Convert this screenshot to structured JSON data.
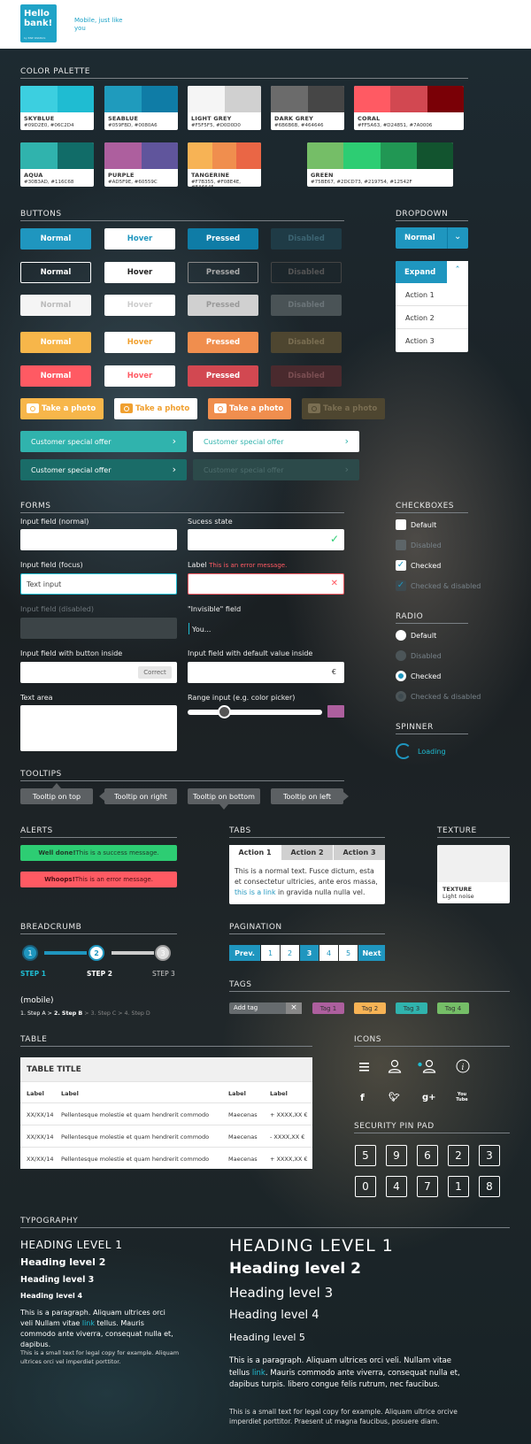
{
  "brand": {
    "logo": "Hello bank!",
    "logo_sub": "by BNP PARIBAS",
    "tagline": "Mobile, just like you"
  },
  "sections": {
    "palette": "COLOR PALETTE",
    "buttons": "BUTTONS",
    "dropdown": "DROPDOWN",
    "forms": "FORMS",
    "checkboxes": "CHECKBOXES",
    "radio": "RADIO",
    "spinner": "SPINNER",
    "tooltips": "TOOLTIPS",
    "alerts": "ALERTS",
    "tabs": "TABS",
    "texture": "TEXTURE",
    "breadcrumb": "BREADCRUMB",
    "pagination": "PAGINATION",
    "tags": "TAGS",
    "table": "TABLE",
    "icons": "ICONS",
    "pinpad": "SECURITY PIN PAD",
    "typography": "TYPOGRAPHY"
  },
  "palette": [
    {
      "name": "SKYBLUE",
      "hex": "#09D2E0, #06C2D4",
      "c": [
        "#3ccfe0",
        "#1fbcd2"
      ]
    },
    {
      "name": "SEABLUE",
      "hex": "#059FBD, #0080A6",
      "c": [
        "#1f9bbd",
        "#0f7ca6"
      ]
    },
    {
      "name": "LIGHT GREY",
      "hex": "#F5F5F5, #D0D0D0",
      "c": [
        "#f5f5f5",
        "#d0d0d0"
      ]
    },
    {
      "name": "DARK GREY",
      "hex": "#6B6B6B, #464646",
      "c": [
        "#6b6b6b",
        "#464646"
      ]
    },
    {
      "name": "CORAL",
      "hex": "#FF5A63, #D24851, #7A0006",
      "c": [
        "#ff5a63",
        "#d24851",
        "#7a0006"
      ]
    },
    {
      "name": "AQUA",
      "hex": "#30B3AD, #116C68",
      "c": [
        "#30b3ad",
        "#116c68"
      ]
    },
    {
      "name": "PURPLE",
      "hex": "#AD5F9E, #60559C",
      "c": [
        "#ad5f9e",
        "#60559c"
      ]
    },
    {
      "name": "TANGERINE",
      "hex": "#F7B355, #F08E4E, #EA6645",
      "c": [
        "#f7b355",
        "#f08e4e",
        "#ea6645"
      ]
    },
    {
      "name": "GREEN",
      "hex": "#75BE67, #2DCD73, #219754, #12542F",
      "c": [
        "#75be67",
        "#2dcd73",
        "#219754",
        "#12542f"
      ]
    }
  ],
  "buttons": {
    "normal": "Normal",
    "hover": "Hover",
    "pressed": "Pressed",
    "disabled": "Disabled",
    "photo": "Take a photo",
    "offer": "Customer special offer"
  },
  "dropdown": {
    "normal": "Normal",
    "expand": "Expand",
    "items": [
      "Action 1",
      "Action 2",
      "Action 3"
    ]
  },
  "forms": {
    "normal_label": "Input field (normal)",
    "success_label": "Sucess state",
    "focus_label": "Input field (focus)",
    "focus_value": "Text input",
    "label": "Label",
    "error_msg": "This is an error message.",
    "disabled_label": "Input field (disabled)",
    "invisible_label": "\"Invisible\" field",
    "invisible_value": "You...",
    "button_inside_label": "Input field with button inside",
    "button_inside_btn": "Correct",
    "default_label": "Input field with default value inside",
    "default_value": "€",
    "textarea_label": "Text area",
    "range_label": "Range input (e.g. color picker)"
  },
  "checkboxes": [
    "Default",
    "Disabled",
    "Checked",
    "Checked & disabled"
  ],
  "radio": [
    "Default",
    "Disabled",
    "Checked",
    "Checked & disabled"
  ],
  "spinner": {
    "label": "Loading"
  },
  "tooltips": [
    "Tooltip on top",
    "Tooltip on right",
    "Tooltip on bottom",
    "Tooltip on left"
  ],
  "alerts": {
    "success_bold": "Well done!",
    "success": " This is a success message.",
    "error_bold": "Whoops!",
    "error": " This is an error message."
  },
  "tabs": {
    "labels": [
      "Action 1",
      "Action 2",
      "Action 3"
    ],
    "text": "This is a normal text. Fusce dictum, esta et consectetur ultricies, ante eros massa,",
    "link": "this is a link",
    "text_end": " in gravida nulla nulla vel."
  },
  "texture": {
    "title": "TEXTURE",
    "sub": "Light noise"
  },
  "breadcrumb": {
    "steps": [
      "1",
      "2",
      "3"
    ],
    "labels": [
      "STEP 1",
      "STEP 2",
      "STEP 3"
    ],
    "mobile_title": "(mobile)",
    "m1": "1. Step A > ",
    "m2": "2. Step B",
    "m3": " > 3. Step C > 4. Step D"
  },
  "pagination": {
    "prev": "Prev.",
    "pages": [
      "1",
      "2",
      "3",
      "4",
      "5"
    ],
    "next": "Next"
  },
  "tags": {
    "input": "Add tag",
    "close": "×",
    "items": [
      "Tag 1",
      "Tag 2",
      "Tag 3",
      "Tag 4"
    ]
  },
  "table": {
    "title": "TABLE TITLE",
    "headers": [
      "Label",
      "Label",
      "Label",
      "Label"
    ],
    "rows": [
      [
        "XX/XX/14",
        "Pellentesque molestie et quam hendrerit commodo",
        "Maecenas",
        "+ XXXX,XX €"
      ],
      [
        "XX/XX/14",
        "Pellentesque molestie et quam hendrerit commodo",
        "Maecenas",
        "- XXXX,XX €"
      ],
      [
        "XX/XX/14",
        "Pellentesque molestie et quam hendrerit commodo",
        "Maecenas",
        "+ XXXX,XX €"
      ]
    ]
  },
  "icons": {
    "row1": [
      "menu-icon",
      "user-icon",
      "user-notify-icon",
      "info-icon"
    ],
    "social": [
      "f",
      "t",
      "g+",
      "You Tube"
    ]
  },
  "pinpad": {
    "keys": [
      "5",
      "9",
      "6",
      "2",
      "3",
      "0",
      "4",
      "7",
      "1",
      "8"
    ]
  },
  "typography": {
    "left": {
      "h1": "HEADING LEVEL 1",
      "h2": "Heading level 2",
      "h3": "Heading level 3",
      "h4": "Heading level 4",
      "p1": "This is a paragraph. Aliquam ultrices orci veli Nullam vitae ",
      "link": "link",
      "p2": " tellus. Mauris commodo ante viverra, consequat nulla et, dapibus.",
      "small": "This is a small text for legal copy for example. Aliquam ultrices orci vel imperdiet porttitor."
    },
    "right": {
      "h1": "HEADING LEVEL 1",
      "h2": "Heading level 2",
      "h3": "Heading level 3",
      "h4": "Heading level 4",
      "h5": "Heading level 5",
      "p1": "This is a paragraph. Aliquam ultrices orci veli. Nullam vitae tellus ",
      "link": "link",
      "p2": ". Mauris commodo ante viverra, consequat nulla et, dapibus turpis. libero congue felis rutrum, nec faucibus.",
      "small": "This is a small text for legal copy for example. Aliquam ultrice orcive imperdiet porttitor. Praesent ut magna faucibus, posuere diam."
    }
  }
}
